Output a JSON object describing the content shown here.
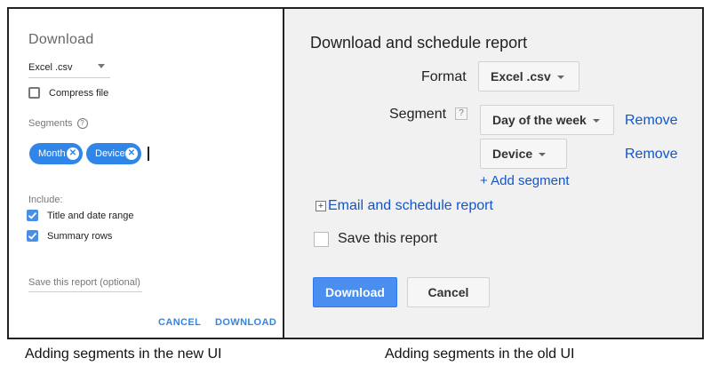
{
  "new_ui": {
    "title": "Download",
    "format_select": {
      "value": "Excel .csv",
      "icon": "chevron-down-icon"
    },
    "compress_file": {
      "label": "Compress file",
      "checked": false
    },
    "segments": {
      "label": "Segments",
      "help_glyph": "?",
      "chips": [
        {
          "label": "Month",
          "remove_glyph": "✕"
        },
        {
          "label": "Device",
          "remove_glyph": "✕"
        }
      ]
    },
    "include": {
      "label": "Include:",
      "options": [
        {
          "label": "Title and date range",
          "checked": true
        },
        {
          "label": "Summary rows",
          "checked": true
        }
      ]
    },
    "save_report": {
      "placeholder": "Save this report (optional)"
    },
    "actions": {
      "cancel": "CANCEL",
      "download": "DOWNLOAD"
    },
    "colors": {
      "accent": "#2f86e8",
      "checkbox": "#4a8fe7"
    }
  },
  "old_ui": {
    "title": "Download and schedule report",
    "format": {
      "label": "Format",
      "value": "Excel .csv"
    },
    "segment": {
      "label": "Segment",
      "help_glyph": "?",
      "rows": [
        {
          "value": "Day of the week",
          "remove": "Remove"
        },
        {
          "value": "Device",
          "remove": "Remove"
        }
      ],
      "add_link": "+ Add segment"
    },
    "email_schedule": {
      "glyph": "+",
      "label": "Email and schedule report"
    },
    "save_report": {
      "label": "Save this report",
      "checked": false
    },
    "actions": {
      "download": "Download",
      "cancel": "Cancel"
    },
    "colors": {
      "primary": "#4a8ef0",
      "link": "#1155cc",
      "panel_bg": "#f1f1f1"
    }
  },
  "captions": {
    "left": "Adding segments in the new UI",
    "right": "Adding segments in the old UI"
  }
}
